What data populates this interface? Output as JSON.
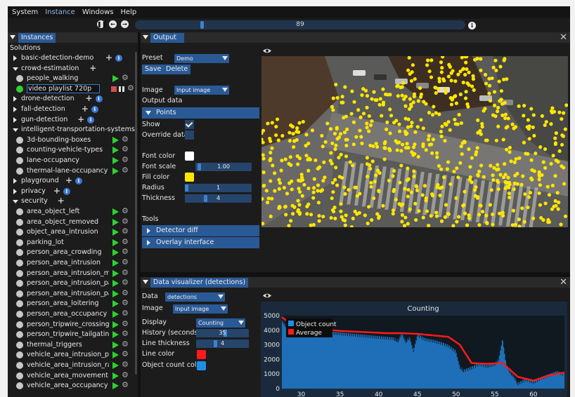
{
  "menu": [
    "System",
    "Instance",
    "Windows",
    "Help"
  ],
  "menu_active": "Instance",
  "toolbar": {
    "frame": "89",
    "frame_fraction": 0.2
  },
  "left": {
    "tab": "Instances",
    "title": "Solutions",
    "tree": [
      {
        "label": "basic-detection-demo",
        "kind": "folder",
        "open": false,
        "info": true
      },
      {
        "label": "crowd-estimation",
        "kind": "folder",
        "open": true,
        "info": false
      },
      {
        "label": "people_walking",
        "kind": "item",
        "status": "idle"
      },
      {
        "label": "video playlist 720p",
        "kind": "item",
        "status": "running",
        "editing": true
      },
      {
        "label": "drone-detection",
        "kind": "folder",
        "open": false,
        "info": true
      },
      {
        "label": "fall-detection",
        "kind": "folder",
        "open": false,
        "info": true
      },
      {
        "label": "gun-detection",
        "kind": "folder",
        "open": false,
        "info": true
      },
      {
        "label": "intelligent-transportation-systems",
        "kind": "folder",
        "open": true,
        "info": false
      },
      {
        "label": "3d-bounding-boxes",
        "kind": "item",
        "status": "idle"
      },
      {
        "label": "counting-vehicle-types",
        "kind": "item",
        "status": "idle"
      },
      {
        "label": "lane-occupancy",
        "kind": "item",
        "status": "idle"
      },
      {
        "label": "thermal-lane-occupancy",
        "kind": "item",
        "status": "idle"
      },
      {
        "label": "playground",
        "kind": "folder",
        "open": false,
        "info": true
      },
      {
        "label": "privacy",
        "kind": "folder",
        "open": false,
        "info": true
      },
      {
        "label": "security",
        "kind": "folder",
        "open": true,
        "info": false
      },
      {
        "label": "area_object_left",
        "kind": "item",
        "status": "idle"
      },
      {
        "label": "area_object_removed",
        "kind": "item",
        "status": "idle"
      },
      {
        "label": "object_area_intrusion",
        "kind": "item",
        "status": "idle"
      },
      {
        "label": "parking_lot",
        "kind": "item",
        "status": "idle"
      },
      {
        "label": "person_area_crowding",
        "kind": "item",
        "status": "idle"
      },
      {
        "label": "person_area_intrusion",
        "kind": "item",
        "status": "idle"
      },
      {
        "label": "person_area_intrusion_motion",
        "kind": "item",
        "status": "idle"
      },
      {
        "label": "person_area_intrusion_parkin",
        "kind": "item",
        "status": "idle"
      },
      {
        "label": "person_area_intrusion_parkin",
        "kind": "item",
        "status": "idle"
      },
      {
        "label": "person_area_loitering",
        "kind": "item",
        "status": "idle"
      },
      {
        "label": "person_area_occupancy",
        "kind": "item",
        "status": "idle"
      },
      {
        "label": "person_tripwire_crossing",
        "kind": "item",
        "status": "idle"
      },
      {
        "label": "person_tripwire_tailgating",
        "kind": "item",
        "status": "idle"
      },
      {
        "label": "thermal_triggers",
        "kind": "item",
        "status": "idle"
      },
      {
        "label": "vehicle_area_intrusion_parkin",
        "kind": "item",
        "status": "idle"
      },
      {
        "label": "vehicle_area_intrusion_rain",
        "kind": "item",
        "status": "idle"
      },
      {
        "label": "vehicle_area_movement",
        "kind": "item",
        "status": "idle"
      },
      {
        "label": "vehicle_area_occupancy",
        "kind": "item",
        "status": "idle"
      }
    ]
  },
  "output": {
    "tab": "Output",
    "preset_label": "Preset",
    "preset_value": "Demo",
    "save": "Save",
    "delete": "Delete",
    "image_label": "Image",
    "image_value": "Input image",
    "output_data": "Output data",
    "points": "Points",
    "show": "Show",
    "override": "Override data",
    "font_color": "Font color",
    "font_scale": "Font scale",
    "font_scale_value": "1.00",
    "fill_color": "Fill color",
    "radius": "Radius",
    "radius_value": "1",
    "thickness": "Thickness",
    "thickness_value": "4",
    "tools": "Tools",
    "detector_diff": "Detector diff",
    "overlay": "Overlay interface",
    "colors": {
      "font": "#ffffff",
      "fill": "#ffe600"
    }
  },
  "dv": {
    "tab": "Data visualizer (detections)",
    "data_label": "Data",
    "data_value": "detections",
    "image_label": "Image",
    "image_value": "Input image",
    "display_label": "Display",
    "display_value": "Counting",
    "history_label": "History (seconds)",
    "history_value": "35",
    "line_thickness_label": "Line thickness",
    "line_thickness_value": "4",
    "line_color_label": "Line color",
    "count_color_label": "Object count color",
    "colors": {
      "line": "#ff1a1a",
      "count": "#1e8fe8"
    }
  },
  "chart_data": {
    "type": "area",
    "title": "Counting",
    "xlim": [
      27.5,
      64
    ],
    "ylim": [
      0,
      5000
    ],
    "xticks": [
      30,
      35,
      40,
      45,
      50,
      55,
      60
    ],
    "yticks": [
      0,
      1000,
      2000,
      3000,
      4000,
      5000
    ],
    "legend": [
      "Object count",
      "Average"
    ],
    "legend_position": "top-left",
    "series": [
      {
        "name": "Object count",
        "color": "#1e6fb8",
        "x": [
          27.5,
          28,
          29,
          30,
          31,
          32,
          33,
          34,
          35,
          36,
          37,
          38,
          39,
          40,
          41,
          42,
          42.5,
          43,
          43.5,
          44,
          44.5,
          45,
          46,
          47,
          48,
          49,
          50,
          50.5,
          51,
          52,
          53,
          54,
          55,
          55.5,
          56,
          56.5,
          57,
          57.5,
          58,
          59,
          60,
          61,
          62,
          63,
          64
        ],
        "y": [
          4800,
          4400,
          4200,
          4100,
          4000,
          4050,
          3950,
          3900,
          3850,
          3800,
          3750,
          3700,
          3650,
          3600,
          3550,
          3500,
          3350,
          3900,
          3300,
          3600,
          2700,
          3750,
          3450,
          3350,
          3200,
          3000,
          2600,
          1550,
          1300,
          1500,
          1750,
          1600,
          1750,
          2100,
          3500,
          1700,
          1200,
          900,
          400,
          700,
          500,
          800,
          1000,
          1200,
          1050
        ]
      },
      {
        "name": "Average",
        "color": "#ff1a1a",
        "x": [
          27.5,
          29,
          31,
          33,
          35,
          37,
          39,
          41,
          43,
          45,
          47,
          49,
          50.5,
          52,
          54,
          56,
          58,
          60,
          62,
          64
        ],
        "y": [
          4900,
          4300,
          4150,
          4050,
          3950,
          3900,
          3850,
          3800,
          3800,
          3750,
          3650,
          3550,
          3000,
          1750,
          1700,
          1750,
          800,
          550,
          900,
          1100
        ]
      }
    ]
  }
}
